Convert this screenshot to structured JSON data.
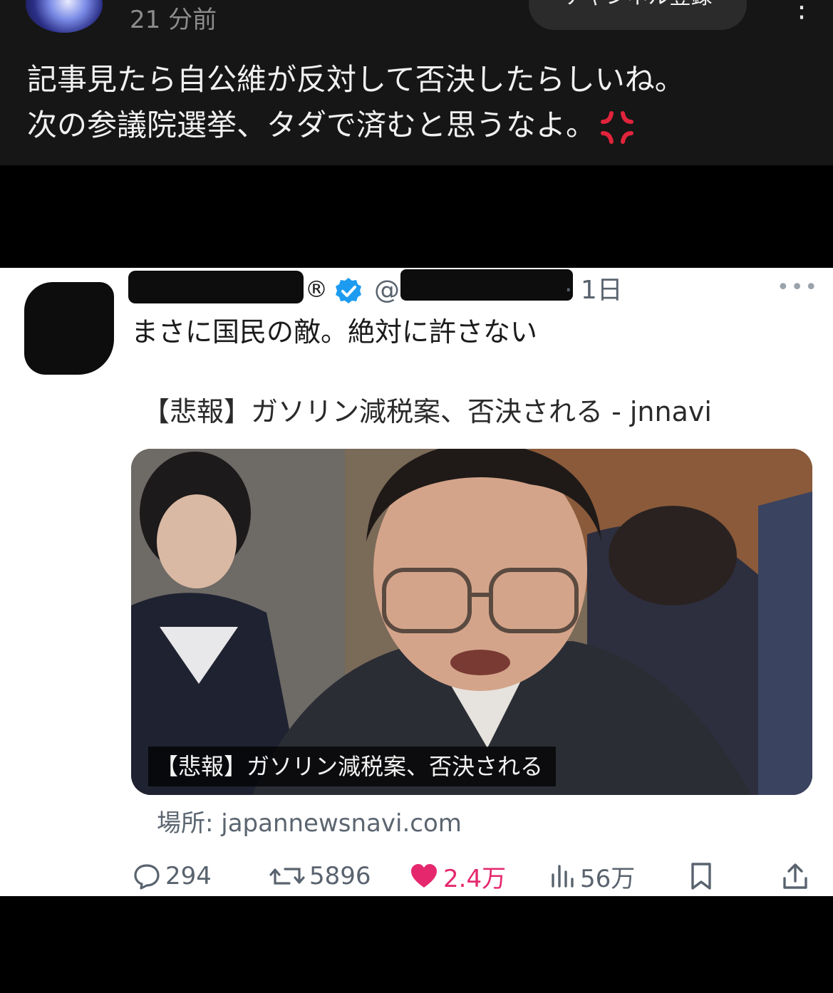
{
  "post": {
    "timestamp": "21 分前",
    "subscribe_label": "チャンネル登録",
    "more_label": "⋮",
    "text_line1": "記事見たら自公維が反対して否決したらしいね。",
    "text_line2": "次の参議院選挙、タダで済むと思うなよ。"
  },
  "tweet": {
    "registered_mark": "®",
    "handle_prefix": "@",
    "time": "· 1日",
    "more_label": "•••",
    "text": "まさに国民の敵。絶対に許さない",
    "link_title": "【悲報】ガソリン減税案、否決される - jnnavi",
    "card_caption": "【悲報】ガソリン減税案、否決される",
    "source": "場所: japannewsnavi.com",
    "replies": "294",
    "retweets": "5896",
    "likes": "2.4万",
    "views": "56万"
  },
  "colors": {
    "like": "#e5286e",
    "verified": "#1d9bf0",
    "anger": "#e0243b"
  }
}
